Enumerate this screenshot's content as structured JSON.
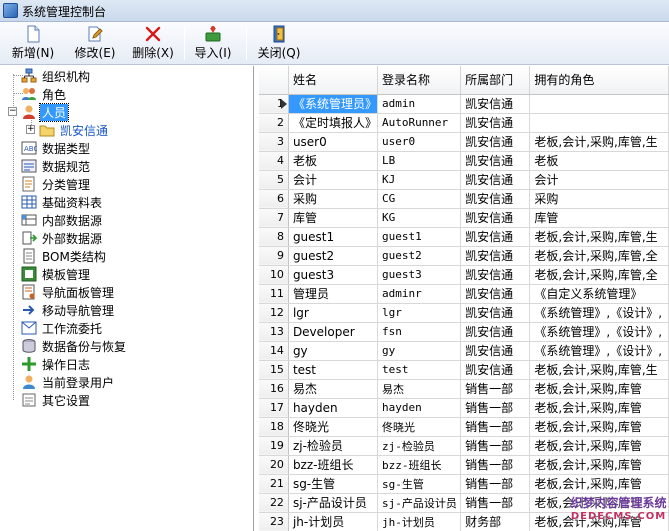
{
  "window": {
    "title": "系统管理控制台"
  },
  "toolbar": {
    "buttons": [
      {
        "label": "新增(N)",
        "icon": "new-doc-icon"
      },
      {
        "label": "修改(E)",
        "icon": "edit-icon"
      },
      {
        "label": "删除(X)",
        "icon": "delete-icon"
      },
      {
        "label": "导入(I)",
        "icon": "import-icon"
      },
      {
        "label": "关闭(Q)",
        "icon": "close-door-icon"
      }
    ]
  },
  "tree": {
    "items": [
      {
        "label": "组织机构",
        "icon": "org-chart-icon"
      },
      {
        "label": "角色",
        "icon": "role-icon"
      },
      {
        "label": "人员",
        "icon": "person-icon",
        "selected": true
      },
      {
        "label": "凯安信通",
        "icon": "folder-icon",
        "child": true
      },
      {
        "label": "数据类型",
        "icon": "data-type-icon"
      },
      {
        "label": "数据规范",
        "icon": "data-spec-icon"
      },
      {
        "label": "分类管理",
        "icon": "category-icon"
      },
      {
        "label": "基础资料表",
        "icon": "table-icon"
      },
      {
        "label": "内部数据源",
        "icon": "internal-source-icon"
      },
      {
        "label": "外部数据源",
        "icon": "external-source-icon"
      },
      {
        "label": "BOM类结构",
        "icon": "bom-icon"
      },
      {
        "label": "模板管理",
        "icon": "template-icon"
      },
      {
        "label": "导航面板管理",
        "icon": "nav-panel-icon"
      },
      {
        "label": "移动导航管理",
        "icon": "mobile-nav-icon"
      },
      {
        "label": "工作流委托",
        "icon": "workflow-icon"
      },
      {
        "label": "数据备份与恢复",
        "icon": "backup-icon"
      },
      {
        "label": "操作日志",
        "icon": "log-icon"
      },
      {
        "label": "当前登录用户",
        "icon": "online-user-icon"
      },
      {
        "label": "其它设置",
        "icon": "settings-icon"
      }
    ]
  },
  "grid": {
    "columns": [
      "姓名",
      "登录名称",
      "所属部门",
      "拥有的角色"
    ],
    "rows": [
      [
        "1",
        "《系统管理员》",
        "admin",
        "凯安信通",
        ""
      ],
      [
        "2",
        "《定时填报人》",
        "AutoRunner",
        "凯安信通",
        ""
      ],
      [
        "3",
        "user0",
        "user0",
        "凯安信通",
        "老板,会计,采购,库管,生"
      ],
      [
        "4",
        "老板",
        "LB",
        "凯安信通",
        "老板"
      ],
      [
        "5",
        "会计",
        "KJ",
        "凯安信通",
        "会计"
      ],
      [
        "6",
        "采购",
        "CG",
        "凯安信通",
        "采购"
      ],
      [
        "7",
        "库管",
        "KG",
        "凯安信通",
        "库管"
      ],
      [
        "8",
        "guest1",
        "guest1",
        "凯安信通",
        "老板,会计,采购,库管,生"
      ],
      [
        "9",
        "guest2",
        "guest2",
        "凯安信通",
        "老板,会计,采购,库管,全"
      ],
      [
        "10",
        "guest3",
        "guest3",
        "凯安信通",
        "老板,会计,采购,库管,全"
      ],
      [
        "11",
        "管理员",
        "adminr",
        "凯安信通",
        "《自定义系统管理》"
      ],
      [
        "12",
        "lgr",
        "lgr",
        "凯安信通",
        "《系统管理》,《设计》,"
      ],
      [
        "13",
        "Developer",
        "fsn",
        "凯安信通",
        "《系统管理》,《设计》,"
      ],
      [
        "14",
        "gy",
        "gy",
        "凯安信通",
        "《系统管理》,《设计》,"
      ],
      [
        "15",
        "test",
        "test",
        "凯安信通",
        "老板,会计,采购,库管,生"
      ],
      [
        "16",
        "易杰",
        "易杰",
        "销售一部",
        "老板,会计,采购,库管"
      ],
      [
        "17",
        "hayden",
        "hayden",
        "销售一部",
        "老板,会计,采购,库管"
      ],
      [
        "18",
        "佟晓光",
        "佟晓光",
        "销售一部",
        "老板,会计,采购,库管"
      ],
      [
        "19",
        "zj-检验员",
        "zj-检验员",
        "销售一部",
        "老板,会计,采购,库管"
      ],
      [
        "20",
        "bzz-班组长",
        "bzz-班组长",
        "销售一部",
        "老板,会计,采购,库管"
      ],
      [
        "21",
        "sg-生管",
        "sg-生管",
        "销售一部",
        "老板,会计,采购,库管"
      ],
      [
        "22",
        "sj-产品设计员",
        "sj-产品设计员",
        "销售一部",
        "老板,会计,采购,库管"
      ],
      [
        "23",
        "jh-计划员",
        "jh-计划员",
        "财务部",
        "老板,会计,采购,库管"
      ]
    ]
  },
  "watermark": {
    "line1": "织梦内容管理系统",
    "line2": "DEDECMS.COM"
  }
}
